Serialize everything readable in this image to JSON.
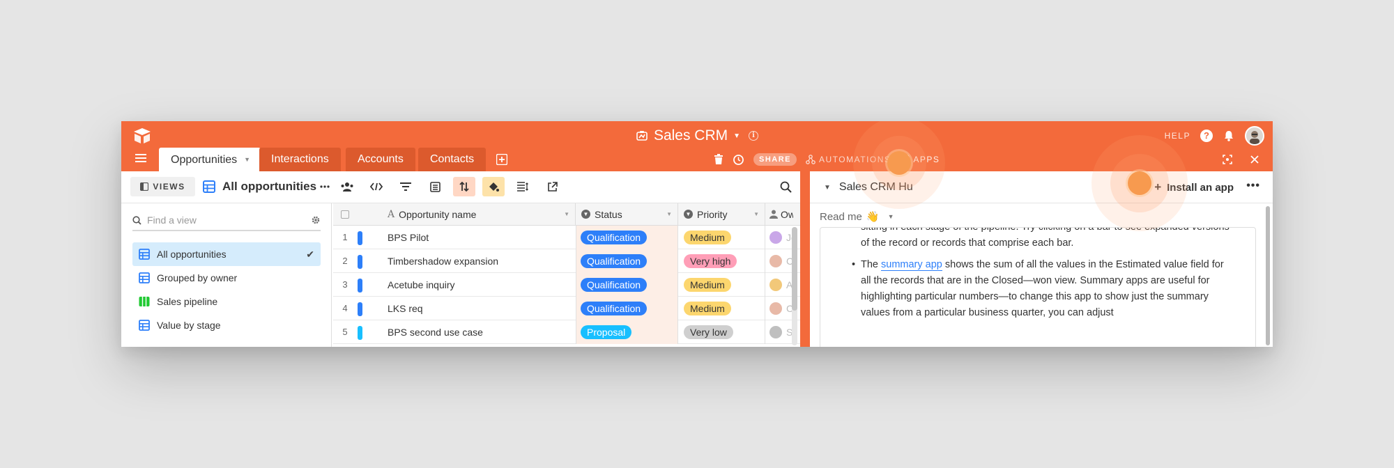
{
  "header": {
    "base_name": "Sales CRM",
    "help_label": "HELP",
    "tabs": [
      {
        "label": "Opportunities"
      },
      {
        "label": "Interactions"
      },
      {
        "label": "Accounts"
      },
      {
        "label": "Contacts"
      }
    ],
    "share_label": "SHARE",
    "automations_label": "AUTOMATIONS",
    "apps_label": "APPS"
  },
  "viewbar": {
    "views_label": "VIEWS",
    "current_view": "All opportunities"
  },
  "sidebar": {
    "find_placeholder": "Find a view",
    "views": [
      {
        "label": "All opportunities",
        "icon": "grid-view-icon",
        "active": true
      },
      {
        "label": "Grouped by owner",
        "icon": "grid-view-icon"
      },
      {
        "label": "Sales pipeline",
        "icon": "kanban-view-icon"
      },
      {
        "label": "Value by stage",
        "icon": "grid-view-icon"
      }
    ]
  },
  "grid": {
    "columns": [
      "Opportunity name",
      "Status",
      "Priority",
      "Owner"
    ],
    "rows": [
      {
        "num": "1",
        "name": "BPS Pilot",
        "status": "Qualification",
        "priority": "Medium",
        "owner": "Jessica",
        "bar": "#2d7ff9"
      },
      {
        "num": "2",
        "name": "Timbershadow expansion",
        "status": "Qualification",
        "priority": "Very high",
        "owner": "Cameron",
        "bar": "#2d7ff9"
      },
      {
        "num": "3",
        "name": "Acetube inquiry",
        "status": "Qualification",
        "priority": "Medium",
        "owner": "Amy",
        "bar": "#2d7ff9"
      },
      {
        "num": "4",
        "name": "LKS req",
        "status": "Qualification",
        "priority": "Medium",
        "owner": "Cameron",
        "bar": "#2d7ff9"
      },
      {
        "num": "5",
        "name": "BPS second use case",
        "status": "Proposal",
        "priority": "Very low",
        "owner": "Simon",
        "bar": "#18bfff"
      }
    ],
    "status_colors": {
      "Qualification": "#2d7ff9",
      "Proposal": "#18bfff"
    },
    "priority_colors": {
      "Medium": "#fcd66e",
      "Very high": "#ff9eb7",
      "Very low": "#cfcfcf"
    }
  },
  "apps": {
    "title": "Sales CRM Hu",
    "install_label": "Install an app",
    "readme_label": "Read me",
    "readme_emoji": "👋",
    "doc": {
      "para1": "sitting in each stage of the pipeline. Try clicking on a bar to see expanded versions of the record or records that comprise each bar.",
      "para2_prefix": "The ",
      "para2_link": "summary app",
      "para2_rest": " shows the sum of all the values in the Estimated value field for all the records that are in the Closed—won view. Summary apps are useful for highlighting particular numbers—to change this app to show just the summary values from a particular business quarter, you can adjust"
    }
  },
  "colors": {
    "brand": "#f36a3b",
    "tab_inactive": "#dc5a2d",
    "active_view_bg": "#d5ecfc"
  }
}
